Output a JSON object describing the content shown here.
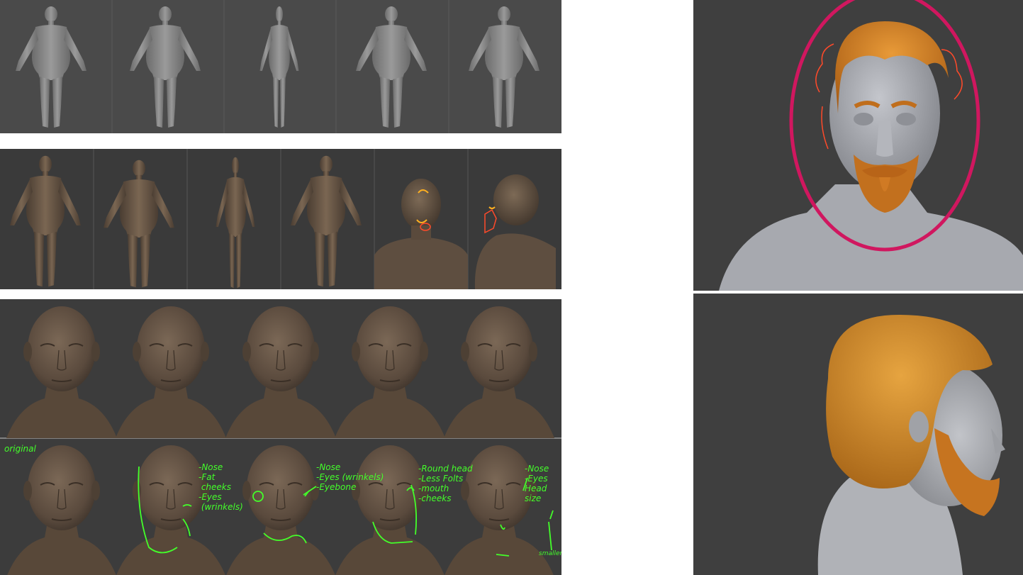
{
  "annotations": {
    "original": "original",
    "note2": [
      "-Nose",
      "-Fat",
      " cheeks",
      "-Eyes",
      " (wrinkels)"
    ],
    "note3": [
      "-Nose",
      "-Eyes (wrinkels)",
      "-Eyebone"
    ],
    "note4": [
      "-Round head",
      "-Less Folts",
      "-mouth",
      "-cheeks"
    ],
    "note5": [
      "-Nose",
      "-Eyes",
      "Head",
      "size",
      "smaller"
    ]
  },
  "colors": {
    "panel_dark": "#404040",
    "sculpt_grey": "#8a8a8a",
    "sculpt_brown": "#6b5a4a",
    "hair_orange": "#d4822a",
    "highlight_circle": "#d0175f",
    "annotation_green": "#43ff2a",
    "annotation_red": "#ff4a2a"
  }
}
